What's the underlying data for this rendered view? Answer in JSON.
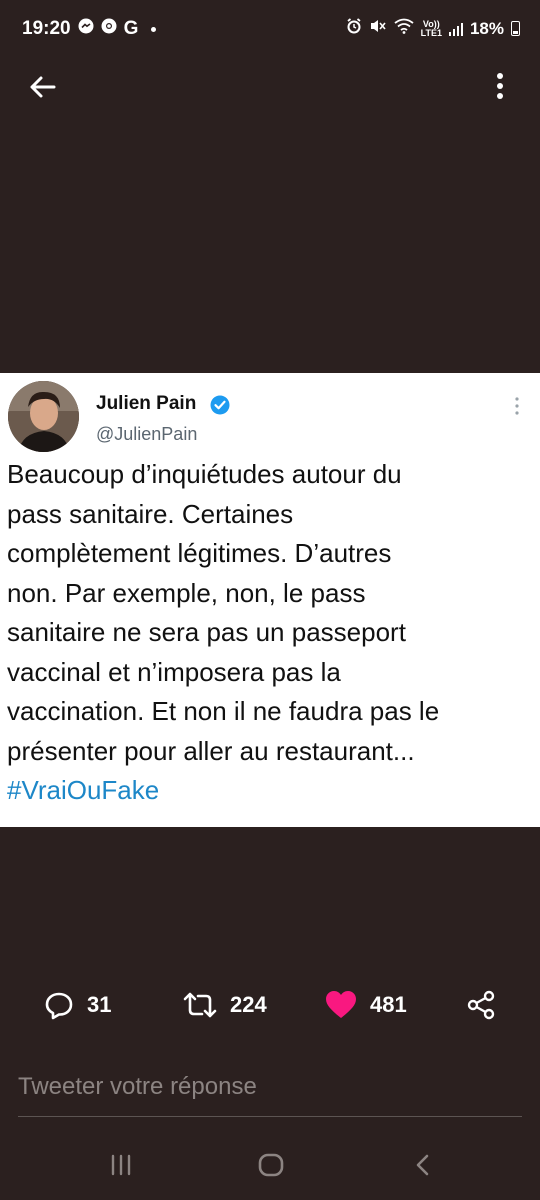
{
  "status_bar": {
    "time": "19:20",
    "left_icons": [
      "messenger-icon",
      "chrome-icon",
      "google-icon",
      "notification-dot"
    ],
    "google_letter": "G",
    "right_icons": [
      "alarm-icon",
      "mute-icon",
      "wifi-icon",
      "volte-icon",
      "signal-icon"
    ],
    "volte_top": "Vo))",
    "volte_bottom": "LTE1",
    "battery": "18%"
  },
  "header": {
    "back_icon": "arrow-left-icon",
    "more_icon": "more-vertical-icon"
  },
  "tweet": {
    "display_name": "Julien Pain",
    "handle": "@JulienPain",
    "verified": true,
    "text": "Beaucoup d’inquiétudes autour du\npass sanitaire. Certaines\ncomplètement légitimes. D’autres\nnon. Par exemple, non, le pass\nsanitaire ne sera pas un passeport\nvaccinal et n’imposera pas la\nvaccination. Et non il ne faudra pas le\nprésenter pour aller au restaurant...",
    "hashtag": "#VraiOuFake",
    "colors": {
      "hashtag": "#1d87c8",
      "verified": "#1d9bf0"
    }
  },
  "actions": {
    "replies": "31",
    "retweets": "224",
    "likes": "481",
    "like_color": "#f91880"
  },
  "reply": {
    "placeholder": "Tweeter votre réponse"
  },
  "nav": {
    "recent_icon": "recent-apps-icon",
    "home_icon": "home-icon",
    "back_icon": "nav-back-icon"
  }
}
